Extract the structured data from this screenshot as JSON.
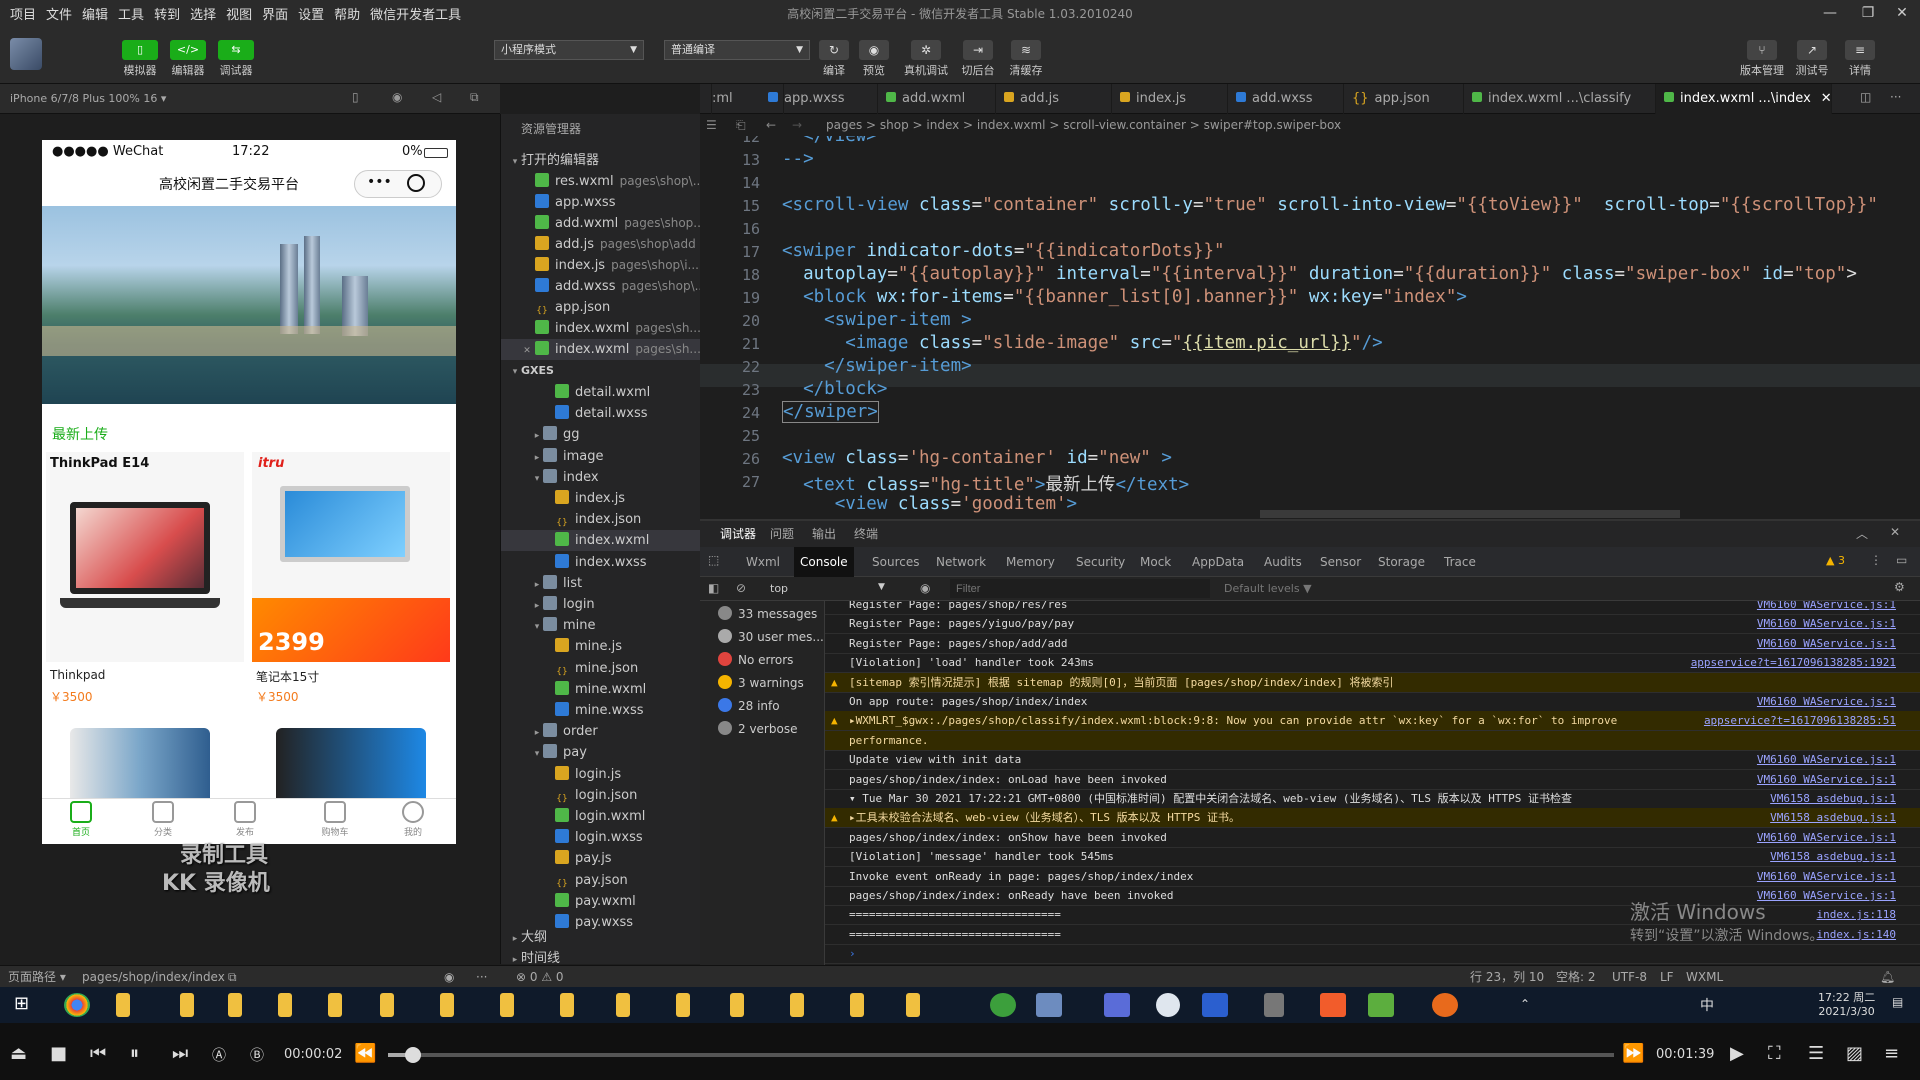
{
  "menubar": {
    "items": [
      "项目",
      "文件",
      "编辑",
      "工具",
      "转到",
      "选择",
      "视图",
      "界面",
      "设置",
      "帮助",
      "微信开发者工具"
    ],
    "title": "高校闲置二手交易平台 - 微信开发者工具 Stable 1.03.2010240"
  },
  "toolbar": {
    "simulator": "模拟器",
    "editor": "编辑器",
    "debugger": "调试器",
    "mode_select": "小程序模式",
    "compile_select": "普通编译",
    "compile": "编译",
    "preview": "预览",
    "real_debug": "真机调试",
    "background": "切后台",
    "clear_cache": "清缓存",
    "version": "版本管理",
    "test": "测试号",
    "detail": "详情"
  },
  "simulator": {
    "device": "iPhone 6/7/8 Plus 100% 16 ▾",
    "status_carrier": "●●●●● WeChat",
    "status_time": "17:22",
    "status_battery": "0%",
    "nav_title": "高校闲置二手交易平台",
    "section_title": "最新上传",
    "goods": [
      {
        "name": "Thinkpad",
        "price": "￥3500",
        "brand": "ThinkPad E14"
      },
      {
        "name": "笔记本15寸",
        "price": "￥3500",
        "brand": "itru",
        "promo": "2399"
      }
    ],
    "tabbar": [
      "首页",
      "分类",
      "发布",
      "购物车",
      "我的"
    ],
    "watermark_line1": "录制工具",
    "watermark_line2": "KK 录像机"
  },
  "explorer": {
    "header": "资源管理器",
    "open_editors": "打开的编辑器",
    "open_files": [
      {
        "name": "res.wxml",
        "path": "pages\\shop\\..."
      },
      {
        "name": "app.wxss",
        "path": ""
      },
      {
        "name": "add.wxml",
        "path": "pages\\shop..."
      },
      {
        "name": "add.js",
        "path": "pages\\shop\\add"
      },
      {
        "name": "index.js",
        "path": "pages\\shop\\i..."
      },
      {
        "name": "add.wxss",
        "path": "pages\\shop\\..."
      },
      {
        "name": "app.json",
        "path": ""
      },
      {
        "name": "index.wxml",
        "path": "pages\\sh..."
      },
      {
        "name": "index.wxml",
        "path": "pages\\sh..."
      }
    ],
    "project": "GXES",
    "tree": [
      "detail.wxml",
      "detail.wxss",
      "gg",
      "image",
      "index",
      "index.js",
      "index.json",
      "index.wxml",
      "index.wxss",
      "list",
      "login",
      "mine",
      "mine.js",
      "mine.json",
      "mine.wxml",
      "mine.wxss",
      "order",
      "pay",
      "login.js",
      "login.json",
      "login.wxml",
      "login.wxss",
      "pay.js",
      "pay.json",
      "pay.wxml",
      "pay.wxss"
    ],
    "outline": "大纲",
    "timeline": "时间线"
  },
  "tabs": [
    {
      "label": ":ml"
    },
    {
      "label": "app.wxss"
    },
    {
      "label": "add.wxml"
    },
    {
      "label": "add.js"
    },
    {
      "label": "index.js"
    },
    {
      "label": "add.wxss"
    },
    {
      "label": "app.json"
    },
    {
      "label": "index.wxml ...\\classify"
    },
    {
      "label": "index.wxml ...\\index"
    }
  ],
  "breadcrumb": "pages > shop > index > index.wxml > scroll-view.container > swiper#top.swiper-box",
  "code": {
    "line_numbers": [
      "12",
      "13",
      "14",
      "15",
      "16",
      "17",
      "18",
      "19",
      "20",
      "21",
      "22",
      "23",
      "24",
      "25",
      "26",
      "27"
    ]
  },
  "devtools": {
    "top_tabs": [
      "调试器",
      "问题",
      "输出",
      "终端"
    ],
    "tabs": [
      "Wxml",
      "Console",
      "Sources",
      "Network",
      "Memory",
      "Security",
      "Mock",
      "AppData",
      "Audits",
      "Sensor",
      "Storage",
      "Trace"
    ],
    "warn_count": "3",
    "context": "top",
    "filter_placeholder": "Filter",
    "levels": "Default levels ▼",
    "sidebar": [
      {
        "label": "33 messages",
        "color": "#888"
      },
      {
        "label": "30 user mes...",
        "color": "#aaa"
      },
      {
        "label": "No errors",
        "color": "#e0443e"
      },
      {
        "label": "3 warnings",
        "color": "#f5b400"
      },
      {
        "label": "28 info",
        "color": "#3b78e7"
      },
      {
        "label": "2 verbose",
        "color": "#888"
      }
    ],
    "logs": [
      {
        "text": "Register Page: pages/shop/res/res",
        "src": "VM6160 WAService.js:1",
        "warn": false
      },
      {
        "text": "Register Page: pages/yiguo/pay/pay",
        "src": "VM6160 WAService.js:1",
        "warn": false
      },
      {
        "text": "Register Page: pages/shop/add/add",
        "src": "VM6160 WAService.js:1",
        "warn": false
      },
      {
        "text": "[Violation] 'load' handler took 243ms",
        "src": "appservice?t=1617096138285:1921",
        "warn": false
      },
      {
        "text": "[sitemap 索引情况提示] 根据 sitemap 的规则[0]，当前页面 [pages/shop/index/index] 将被索引",
        "src": "",
        "warn": true
      },
      {
        "text": "On app route: pages/shop/index/index",
        "src": "VM6160 WAService.js:1",
        "warn": false
      },
      {
        "text": "▸WXMLRT_$gwx:./pages/shop/classify/index.wxml:block:9:8: Now you can provide attr `wx:key` for a `wx:for` to improve",
        "src": "appservice?t=1617096138285:51",
        "warn": true
      },
      {
        "text": "performance.",
        "src": "",
        "warn": true
      },
      {
        "text": "Update view with init data",
        "src": "VM6160 WAService.js:1",
        "warn": false
      },
      {
        "text": "pages/shop/index/index: onLoad have been invoked",
        "src": "VM6160 WAService.js:1",
        "warn": false
      },
      {
        "text": "▾ Tue Mar 30 2021 17:22:21 GMT+0800 (中国标准时间) 配置中关闭合法域名、web-view (业务域名)、TLS 版本以及 HTTPS 证书检查",
        "src": "VM6158 asdebug.js:1",
        "warn": false
      },
      {
        "text": "  ▸工具未校验合法域名、web-view（业务域名）、TLS 版本以及 HTTPS 证书。",
        "src": "VM6158 asdebug.js:1",
        "warn": true
      },
      {
        "text": "pages/shop/index/index: onShow have been invoked",
        "src": "VM6160 WAService.js:1",
        "warn": false
      },
      {
        "text": "[Violation] 'message' handler took 545ms",
        "src": "VM6158 asdebug.js:1",
        "warn": false
      },
      {
        "text": "Invoke event onReady in page: pages/shop/index/index",
        "src": "VM6160 WAService.js:1",
        "warn": false
      },
      {
        "text": "pages/shop/index/index: onReady have been invoked",
        "src": "VM6160 WAService.js:1",
        "warn": false
      },
      {
        "text": "================================",
        "src": "index.js:118",
        "warn": false
      },
      {
        "text": "================================",
        "src": "index.js:140",
        "warn": false
      }
    ]
  },
  "windows_watermark": {
    "line1": "激活 Windows",
    "line2": "转到“设置”以激活 Windows。"
  },
  "statusbar": {
    "path_label": "页面路径 ▾",
    "path": "pages/shop/index/index",
    "problems": "⊗ 0 ⚠ 0",
    "position": "行 23，列 10",
    "spaces": "空格: 2",
    "encoding": "UTF-8",
    "eol": "LF",
    "lang": "WXML"
  },
  "taskbar": {
    "time": "17:22 周二",
    "date": "2021/3/30",
    "ime": "中"
  },
  "player": {
    "elapsed": "00:00:02",
    "total": "00:01:39",
    "progress": 0.02
  }
}
